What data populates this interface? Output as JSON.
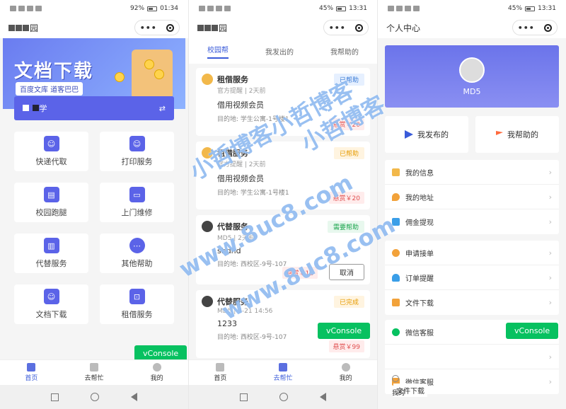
{
  "phone1": {
    "status": {
      "battery": "92%",
      "time": "01:34"
    },
    "nav_title_suffix": "园",
    "banner": {
      "title": "文档下载",
      "subtitle": "百度文库 道客巴巴"
    },
    "school_suffix": "学",
    "switch_icon": "⇄",
    "grid": [
      {
        "label": "快递代取",
        "icon": "user-icon"
      },
      {
        "label": "打印服务",
        "icon": "user-icon"
      },
      {
        "label": "校园跑腿",
        "icon": "printer-icon"
      },
      {
        "label": "上门维修",
        "icon": "monitor-icon"
      },
      {
        "label": "代替服务",
        "icon": "book-icon"
      },
      {
        "label": "其他帮助",
        "icon": "more-icon"
      },
      {
        "label": "文档下载",
        "icon": "user-icon"
      },
      {
        "label": "租借服务",
        "icon": "cart-icon"
      }
    ],
    "vconsole": "vConsole",
    "bottom_nav": [
      "首页",
      "去帮忙",
      "我的"
    ]
  },
  "phone2": {
    "status": {
      "battery": "45%",
      "time": "13:31"
    },
    "nav_title_suffix": "园",
    "tabs": [
      "校园帮",
      "我发出的",
      "我帮助的"
    ],
    "cards": [
      {
        "title": "租借服务",
        "meta": "官方提醒 | 2天前",
        "body": "借用视频会员",
        "dest": "目的地: 学生公寓-1号楼1",
        "badge": "已帮助",
        "badge_type": "blue",
        "reward": "悬赏￥20",
        "av": "light"
      },
      {
        "title": "租借服务",
        "meta": "官方提醒 | 2天前",
        "body": "借用视频会员",
        "dest": "目的地: 学生公寓-1号楼1",
        "badge": "已帮助",
        "badge_type": "orange",
        "reward": "悬赏￥20",
        "av": "light"
      },
      {
        "title": "代替服务",
        "meta": "MD5 | 2天前",
        "body": "shdhd",
        "dest": "目的地: 西校区-9号-107",
        "badge": "需要帮助",
        "badge_type": "green",
        "reward": "悬赏￥12",
        "cancel": "取消",
        "av": "dark"
      },
      {
        "title": "代替服务",
        "meta": "MD5 | 6-21 14:56",
        "body": "1233",
        "dest": "目的地: 西校区-9号-107",
        "badge": "已完成",
        "badge_type": "orange",
        "reward": "悬赏￥99",
        "av": "dark"
      }
    ],
    "vconsole": "vConsole",
    "bottom_nav": [
      "首页",
      "去帮忙",
      "我的"
    ]
  },
  "phone3": {
    "status": {
      "battery": "45%",
      "time": "13:31"
    },
    "nav_title": "个人中心",
    "username": "MD5",
    "actions": [
      "我发布的",
      "我帮助的"
    ],
    "menu1": [
      {
        "label": "我的信息",
        "color": "#f2b84a"
      },
      {
        "label": "我的地址",
        "color": "#f2a23a"
      },
      {
        "label": "佣金提现",
        "color": "#3a9ee8"
      }
    ],
    "menu2": [
      {
        "label": "申请接单",
        "color": "#f2a23a"
      },
      {
        "label": "订单提醒",
        "color": "#3a9ee8"
      },
      {
        "label": "文件下载",
        "color": "#f2a23a"
      }
    ],
    "menu3": [
      {
        "label": "微信客服",
        "color": "#07c160"
      },
      {
        "label": "",
        "color": "#ffffff"
      },
      {
        "label": "微信客服",
        "color": "#f2a23a"
      }
    ],
    "overlay_file": "文件下载",
    "overlay_mine": "我的",
    "vconsole": "vConsole"
  },
  "watermarks": [
    "小哲博客小哲博客",
    "小哲博客",
    "www.8uc8.com",
    "www.8uc8.com"
  ]
}
